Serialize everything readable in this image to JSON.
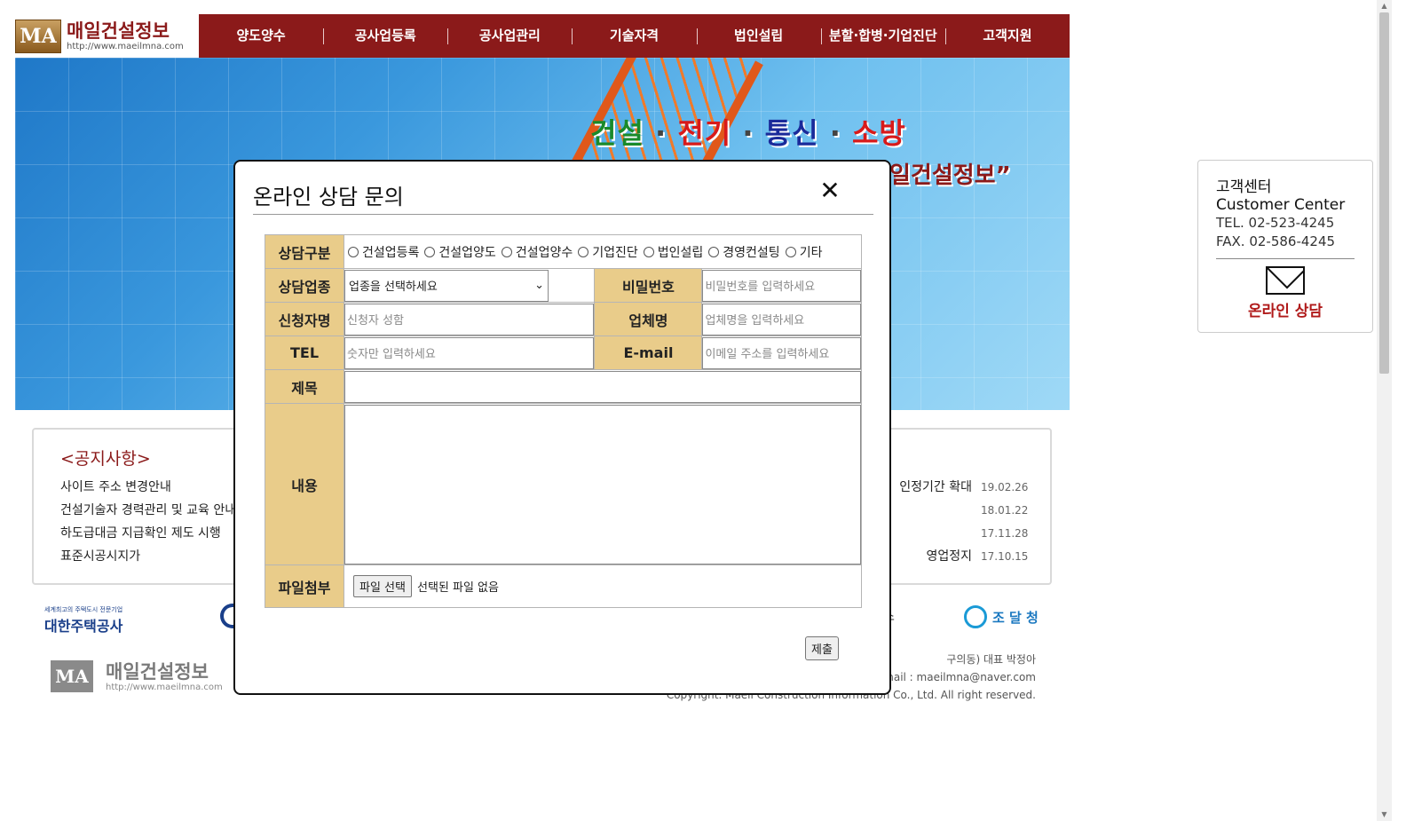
{
  "header": {
    "logo_mark": "MA",
    "logo_name": "매일건설정보",
    "logo_url": "http://www.maeilmna.com",
    "nav": [
      "양도양수",
      "공사업등록",
      "공사업관리",
      "기술자격",
      "법인설립",
      "분할·합병·기업진단",
      "고객지원"
    ]
  },
  "hero": {
    "line1": [
      "건설",
      "전기",
      "통신",
      "소방"
    ],
    "separator": "·",
    "line2": "일건설정보”"
  },
  "notice": {
    "title": "<공지사항>",
    "items": [
      "사이트 주소 변경안내",
      "건설기술자 경력관리 및 교육 안내",
      "하도급대금 지급확인 제도 시행",
      "표준시공시지가"
    ],
    "right_items": [
      {
        "text": "인정기간 확대",
        "date": "19.02.26"
      },
      {
        "text": "",
        "date": "18.01.22"
      },
      {
        "text": "",
        "date": "17.11.28"
      },
      {
        "text": "영업정지",
        "date": "17.10.15"
      }
    ]
  },
  "partners": {
    "left_small": "세계최고의 주택도시 전문기업",
    "left_name": "대한주택공사",
    "mid": "스",
    "right_name": "조 달 청"
  },
  "footer": {
    "logo_name": "매일건설정보",
    "logo_url": "http://www.maeilmna.com",
    "info1": "구의동) 대표 박정아",
    "info2": "E-mail : maeilmna@naver.com",
    "info3": "Copyright. Maeil Construction Information Co., Ltd. All right reserved."
  },
  "customer_center": {
    "title_ko": "고객센터",
    "title_en": "Customer Center",
    "tel": "TEL. 02-523-4245",
    "fax": "FAX. 02-586-4245",
    "online_label": "온라인 상담"
  },
  "modal": {
    "title": "온라인 상담 문의",
    "close": "✕",
    "labels": {
      "category": "상담구분",
      "industry": "상담업종",
      "password": "비밀번호",
      "applicant": "신청자명",
      "company": "업체명",
      "tel": "TEL",
      "email": "E-mail",
      "subject": "제목",
      "content": "내용",
      "file": "파일첨부"
    },
    "category_options": [
      "건설업등록",
      "건설업양도",
      "건설업양수",
      "기업진단",
      "법인설립",
      "경영컨설팅",
      "기타"
    ],
    "industry_selected": "업종을 선택하세요",
    "placeholders": {
      "password": "비밀번호를 입력하세요",
      "applicant": "신청자 성함",
      "company": "업체명을 입력하세요",
      "tel": "숫자만 입력하세요",
      "email": "이메일 주소를 입력하세요"
    },
    "file_button": "파일 선택",
    "file_status": "선택된 파일 없음",
    "submit": "제출"
  }
}
